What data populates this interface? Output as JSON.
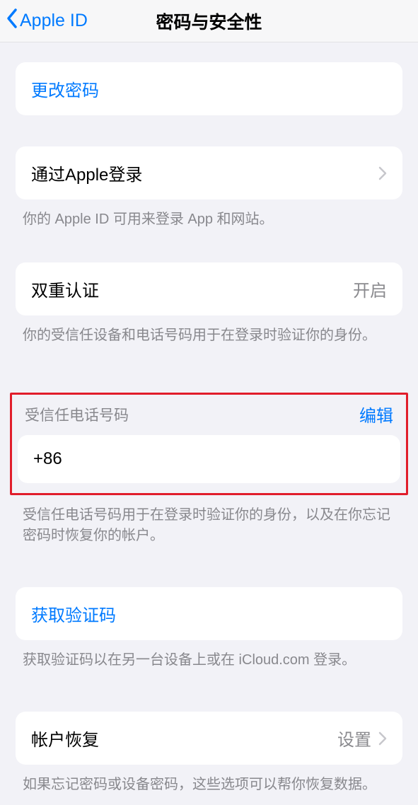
{
  "nav": {
    "back_label": "Apple ID",
    "title": "密码与安全性"
  },
  "change_password": {
    "label": "更改密码"
  },
  "sign_in_with_apple": {
    "label": "通过Apple登录",
    "footer": "你的 Apple ID 可用来登录 App 和网站。"
  },
  "two_factor": {
    "label": "双重认证",
    "value": "开启",
    "footer": "你的受信任设备和电话号码用于在登录时验证你的身份。"
  },
  "trusted_phone": {
    "header": "受信任电话号码",
    "edit_label": "编辑",
    "number": "+86",
    "footer": "受信任电话号码用于在登录时验证你的身份，以及在你忘记密码时恢复你的帐户。"
  },
  "get_code": {
    "label": "获取验证码",
    "footer": "获取验证码以在另一台设备上或在 iCloud.com 登录。"
  },
  "account_recovery": {
    "label": "帐户恢复",
    "value": "设置",
    "footer": "如果忘记密码或设备密码，这些选项可以帮你恢复数据。"
  }
}
